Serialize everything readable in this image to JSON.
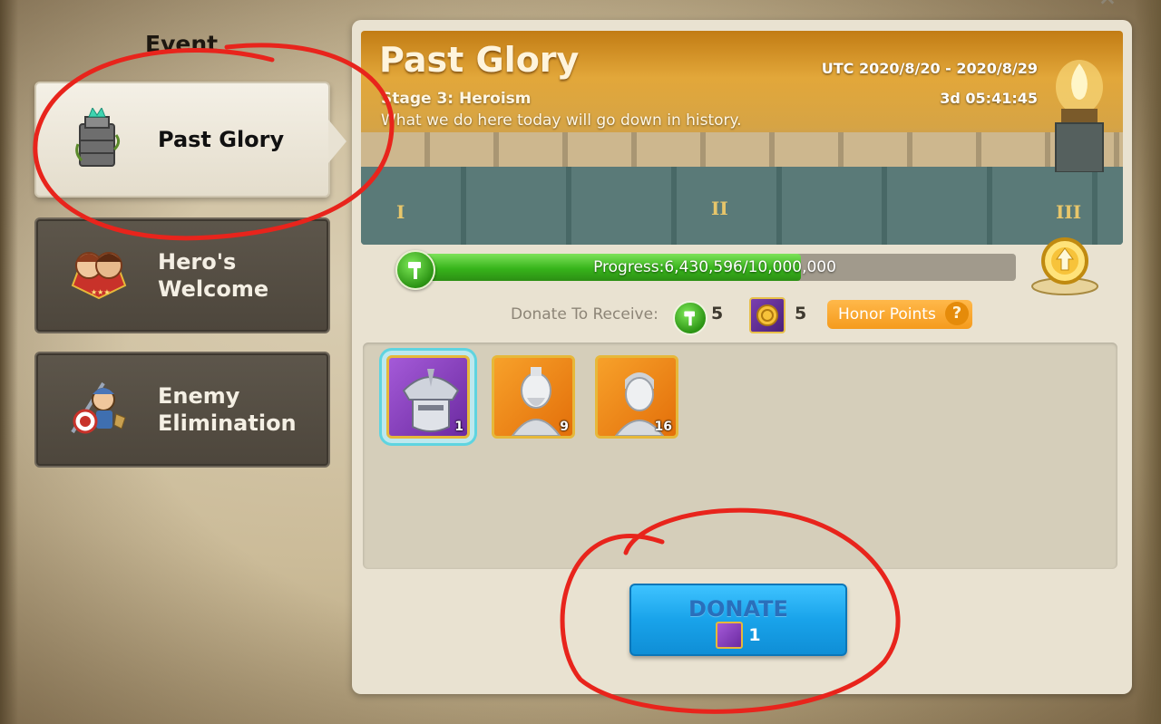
{
  "sidebar": {
    "title": "Event",
    "items": [
      {
        "label": "Past Glory",
        "active": true,
        "icon": "stone-tower-icon"
      },
      {
        "label": "Hero's Welcome",
        "active": false,
        "icon": "heroes-crest-icon"
      },
      {
        "label": "Enemy Elimination",
        "active": false,
        "icon": "soldier-target-icon"
      }
    ]
  },
  "banner": {
    "title": "Past Glory",
    "stage": "Stage 3: Heroism",
    "quote": "What we do here today will go down in history.",
    "date_range": "UTC 2020/8/20 - 2020/8/29",
    "time_left": "3d 05:41:45",
    "stage_marks": [
      "I",
      "II",
      "III"
    ]
  },
  "progress": {
    "label": "Progress:",
    "value_text": "6,430,596/10,000,000",
    "current": 6430596,
    "total": 10000000
  },
  "rewards": {
    "label": "Donate To Receive:",
    "hammer_amount": "5",
    "coin_amount": "5",
    "honor_points_label": "Honor Points",
    "help_glyph": "?"
  },
  "items": [
    {
      "name": "samurai-sculpture",
      "count": "1",
      "rarity": "purple",
      "selected": true
    },
    {
      "name": "general-bust",
      "count": "9",
      "rarity": "orange",
      "selected": false
    },
    {
      "name": "soldier-bust",
      "count": "16",
      "rarity": "orange",
      "selected": false
    }
  ],
  "donate_button": {
    "label": "DONATE",
    "cost": "1"
  },
  "colors": {
    "progress_green": "#37b41b",
    "donate_blue": "#19a3ea",
    "honor_orange": "#f59b1d",
    "annotation_red": "#e8241c"
  }
}
